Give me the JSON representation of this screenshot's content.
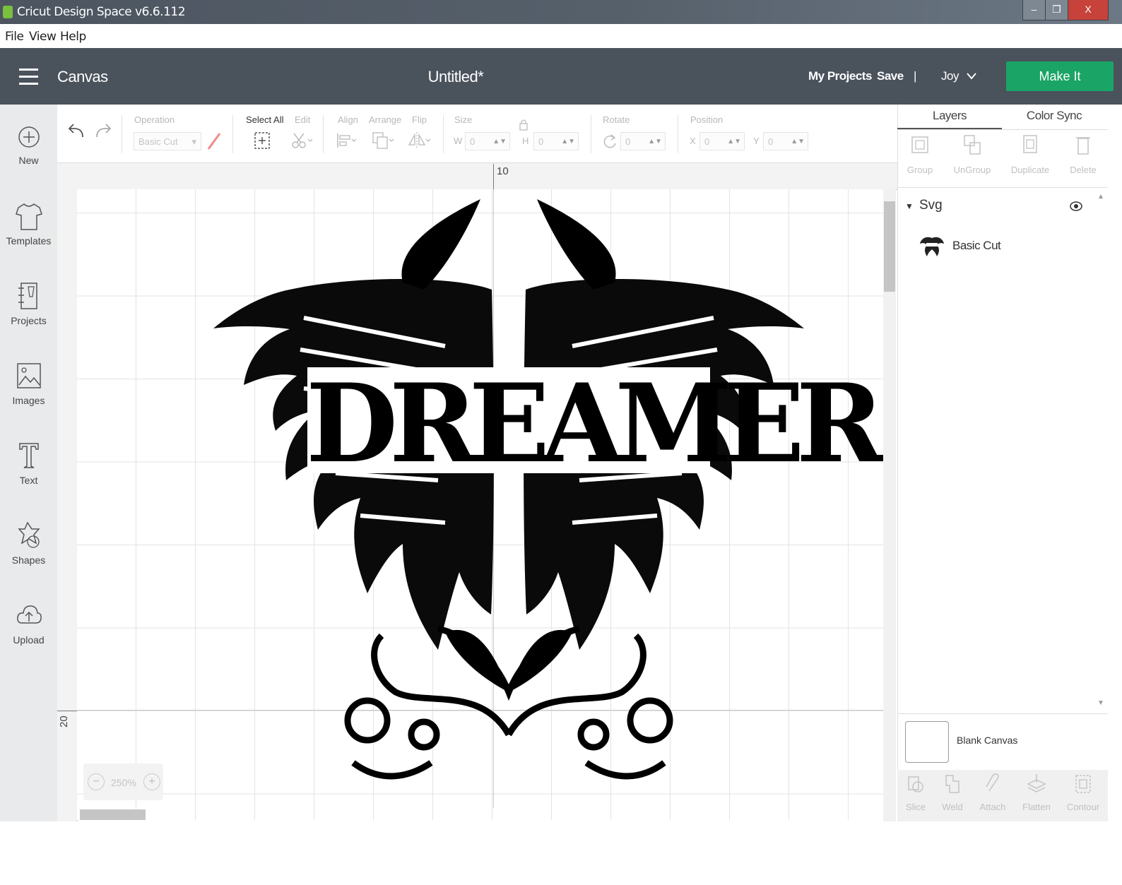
{
  "window": {
    "title": "Cricut Design Space  v6.6.112",
    "controls": {
      "minimize": "–",
      "restore": "❐",
      "close": "X"
    }
  },
  "menubar": {
    "items": [
      "File",
      "View",
      "Help"
    ]
  },
  "header": {
    "section": "Canvas",
    "document_title": "Untitled*",
    "my_projects": "My Projects",
    "save": "Save",
    "separator": "|",
    "user": "Joy",
    "make_it": "Make It",
    "accent_color": "#1aa466"
  },
  "sidebar": {
    "items": [
      {
        "label": "New",
        "icon": "plus-circle-icon"
      },
      {
        "label": "Templates",
        "icon": "tshirt-icon"
      },
      {
        "label": "Projects",
        "icon": "notebook-icon"
      },
      {
        "label": "Images",
        "icon": "image-icon"
      },
      {
        "label": "Text",
        "icon": "text-t-icon"
      },
      {
        "label": "Shapes",
        "icon": "shapes-icon"
      },
      {
        "label": "Upload",
        "icon": "upload-cloud-icon"
      }
    ]
  },
  "toolbar": {
    "operation_label": "Operation",
    "operation_value": "Basic Cut",
    "select_all": "Select All",
    "edit": "Edit",
    "align": "Align",
    "arrange": "Arrange",
    "flip": "Flip",
    "size": "Size",
    "width_label": "W",
    "width_value": "0",
    "height_label": "H",
    "height_value": "0",
    "rotate": "Rotate",
    "rotate_value": "0",
    "position": "Position",
    "x_label": "X",
    "x_value": "0",
    "y_label": "Y",
    "y_value": "0"
  },
  "rulers": {
    "top_mark": "10",
    "left_mark": "20"
  },
  "canvas": {
    "design_text": "DREAMER",
    "zoom": "250%",
    "zoom_out": "−",
    "zoom_in": "+"
  },
  "panel": {
    "tabs": [
      "Layers",
      "Color Sync"
    ],
    "actions": [
      "Group",
      "UnGroup",
      "Duplicate",
      "Delete"
    ],
    "layer_group": "Svg",
    "layer_item": "Basic Cut",
    "blank_canvas": "Blank Canvas",
    "bottom_actions": [
      "Slice",
      "Weld",
      "Attach",
      "Flatten",
      "Contour"
    ]
  }
}
